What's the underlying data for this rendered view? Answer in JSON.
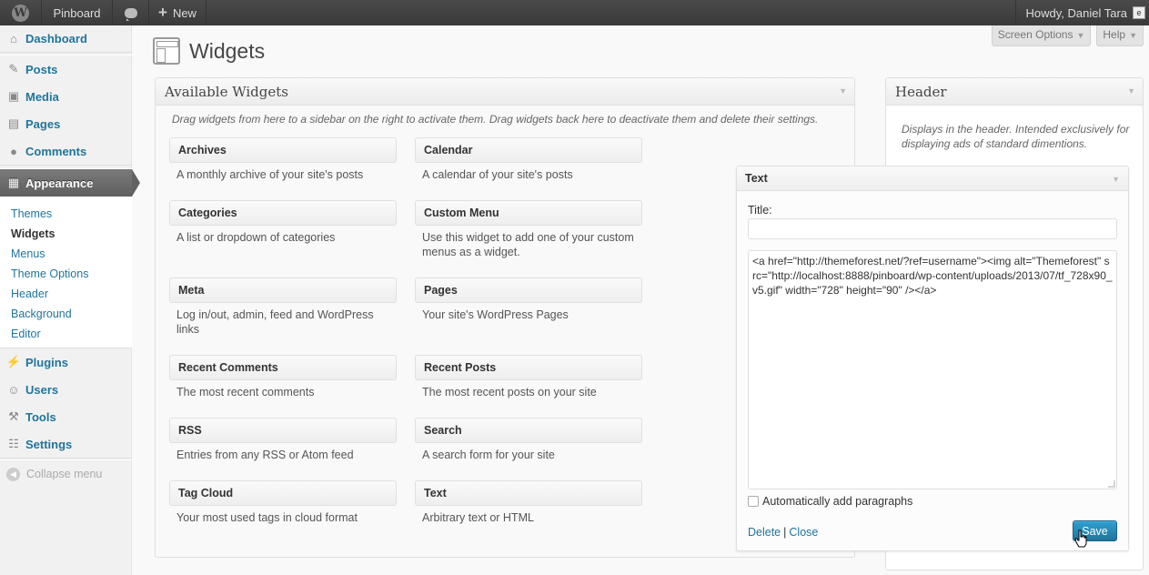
{
  "adminbar": {
    "site_name": "Pinboard",
    "new_label": "New",
    "howdy": "Howdy, Daniel Tara"
  },
  "menu": {
    "dashboard": "Dashboard",
    "posts": "Posts",
    "media": "Media",
    "pages": "Pages",
    "comments": "Comments",
    "appearance": "Appearance",
    "submenu": [
      "Themes",
      "Widgets",
      "Menus",
      "Theme Options",
      "Header",
      "Background",
      "Editor"
    ],
    "plugins": "Plugins",
    "users": "Users",
    "tools": "Tools",
    "settings": "Settings",
    "collapse": "Collapse menu"
  },
  "screen_meta": {
    "screen_options": "Screen Options",
    "help": "Help"
  },
  "page": {
    "title": "Widgets"
  },
  "available": {
    "title": "Available Widgets",
    "description": "Drag widgets from here to a sidebar on the right to activate them. Drag widgets back here to deactivate them and delete their settings.",
    "widgets": [
      {
        "title": "Archives",
        "desc": "A monthly archive of your site's posts"
      },
      {
        "title": "Calendar",
        "desc": "A calendar of your site's posts"
      },
      {
        "title": "Categories",
        "desc": "A list or dropdown of categories"
      },
      {
        "title": "Custom Menu",
        "desc": "Use this widget to add one of your custom menus as a widget."
      },
      {
        "title": "Meta",
        "desc": "Log in/out, admin, feed and WordPress links"
      },
      {
        "title": "Pages",
        "desc": "Your site's WordPress Pages"
      },
      {
        "title": "Recent Comments",
        "desc": "The most recent comments"
      },
      {
        "title": "Recent Posts",
        "desc": "The most recent posts on your site"
      },
      {
        "title": "RSS",
        "desc": "Entries from any RSS or Atom feed"
      },
      {
        "title": "Search",
        "desc": "A search form for your site"
      },
      {
        "title": "Tag Cloud",
        "desc": "Your most used tags in cloud format"
      },
      {
        "title": "Text",
        "desc": "Arbitrary text or HTML"
      }
    ]
  },
  "header_sidebar": {
    "title": "Header",
    "description": "Displays in the header. Intended exclusively for displaying ads of standard dimentions."
  },
  "text_widget": {
    "title": "Text",
    "title_label": "Title:",
    "title_value": "",
    "content": "<a href=\"http://themeforest.net/?ref=username\"><img alt=\"Themeforest\" src=\"http://localhost:8888/pinboard/wp-content/uploads/2013/07/tf_728x90_v5.gif\" width=\"728\" height=\"90\" /></a>",
    "autop_label": "Automatically add paragraphs",
    "autop_checked": false,
    "delete_label": "Delete",
    "close_label": "Close",
    "save_label": "Save"
  }
}
